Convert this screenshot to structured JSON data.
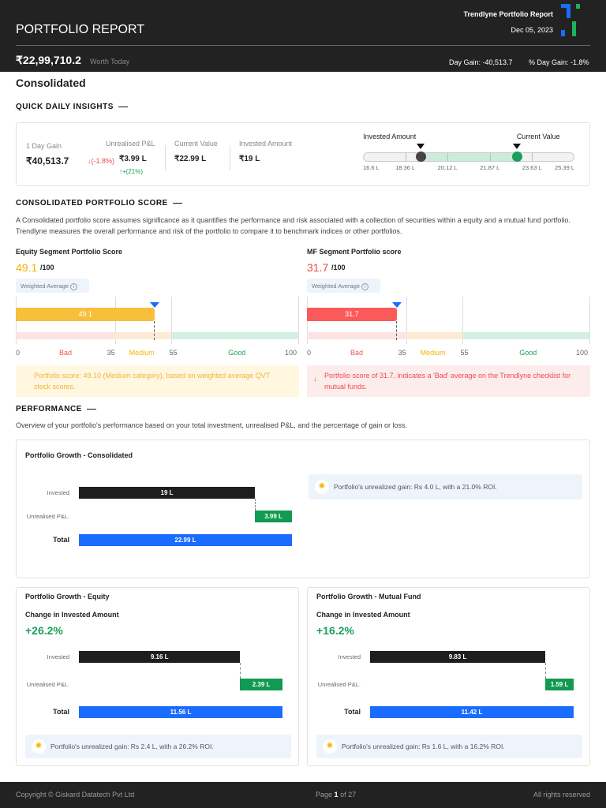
{
  "header": {
    "title": "PORTFOLIO REPORT",
    "brand": "Trendlyne Portfolio Report",
    "date": "Dec 05, 2023",
    "worth": "₹22,99,710.2",
    "worth_label": "Worth Today",
    "day_gain": "Day Gain: -40,513.7",
    "pct_day_gain": "% Day Gain: -1.8%"
  },
  "page_title": "Consolidated",
  "insights": {
    "heading": "QUICK DAILY INSIGHTS",
    "day_gain_label": "1 Day Gain",
    "day_gain_value": "₹40,513.7",
    "day_gain_pct": "↓(-1.8%)",
    "pnl_label": "Unrealised P&L",
    "pnl_value": "₹3.99 L",
    "pnl_pct": "↑+(21%)",
    "current_label": "Current Value",
    "current_value": "₹22.99 L",
    "invested_label": "Invested Amount",
    "invested_value": "₹19 L",
    "range": {
      "invested_label": "Invested Amount",
      "current_label": "Current Value",
      "ticks": [
        "16.6 L",
        "18.36 L",
        "20.12 L",
        "21.87 L",
        "23.63 L",
        "25.39 L"
      ],
      "min": 16.6,
      "max": 25.39,
      "invested": 19,
      "current": 22.99
    }
  },
  "score": {
    "heading": "CONSOLIDATED PORTFOLIO SCORE",
    "description": "A Consolidated portfolio score assumes significance as it quantifies the performance and risk associated with a collection of securities within a equity and a mutual fund portfolio. Trendlyne measures the overall performance and risk of the portfolio to compare it to benchmark indices or other portfolios.",
    "segments": [
      {
        "title": "Equity Segment Portfolio Score",
        "score": "49.1",
        "value": 49.1,
        "out_of": "/100",
        "chip": "Weighted Average",
        "color": "#f8bf3a",
        "score_color": "#f5b400",
        "note": "Portfolio score: 49.10 (Medium category), based on weighted average QVT stock scores.",
        "note_bg": "#fff7e0",
        "note_color": "#f0b43a",
        "note_icon": ""
      },
      {
        "title": "MF Segment Portfolio score",
        "score": "31.7",
        "value": 31.7,
        "out_of": "/100",
        "chip": "Weighted Average",
        "color": "#fb5a5a",
        "score_color": "#f04848",
        "note": "Portfolio score of 31.7, indicates a 'Bad' average on the Trendlyne checklist for mutual funds.",
        "note_bg": "#fdecec",
        "note_color": "#ef4b4b",
        "note_icon": "↓"
      }
    ],
    "scale": {
      "t0": "0",
      "t35": "35",
      "t55": "55",
      "t100": "100",
      "bad": "Bad",
      "medium": "Medium",
      "good": "Good"
    }
  },
  "performance": {
    "heading": "PERFORMANCE",
    "description": "Overview of your portfolio's performance based on your total investment, unrealised P&L, and the percentage of gain or loss.",
    "consolidated": {
      "title": "Portfolio Growth - Consolidated",
      "invested_label": "Invested",
      "pnl_label": "Unrealised P&L.",
      "total_label": "Total",
      "invested": 19,
      "invested_text": "19 L",
      "pnl": 3.99,
      "pnl_text": "3.99 L",
      "total": 22.99,
      "total_text": "22.99 L",
      "tip": "Portfolio's unrealized gain: Rs 4.0 L, with a 21.0% ROI."
    },
    "equity": {
      "title": "Portfolio Growth - Equity",
      "change_label": "Change in Invested Amount",
      "change": "+26.2%",
      "invested_label": "Invested",
      "pnl_label": "Unrealised P&L.",
      "total_label": "Total",
      "invested": 9.16,
      "invested_text": "9.16 L",
      "pnl": 2.39,
      "pnl_text": "2.39 L",
      "total": 11.56,
      "total_text": "11.56 L",
      "tip": "Portfolio's unrealized gain: Rs 2.4 L, with a 26.2% ROI."
    },
    "mf": {
      "title": "Portfolio Growth - Mutual Fund",
      "change_label": "Change in Invested Amount",
      "change": "+16.2%",
      "invested_label": "Invested",
      "pnl_label": "Unrealised P&L.",
      "total_label": "Total",
      "invested": 9.83,
      "invested_text": "9.83 L",
      "pnl": 1.59,
      "pnl_text": "1.59 L",
      "total": 11.42,
      "total_text": "11.42 L",
      "tip": "Portfolio's unrealized gain: Rs 1.6 L, with a 16.2% ROI."
    }
  },
  "footer": {
    "copyright": "Copyright © Giskard Datatech Pvt Ltd",
    "page_prefix": "Page",
    "page": "1",
    "page_of": "of 27",
    "rights": "All rights reserved"
  }
}
